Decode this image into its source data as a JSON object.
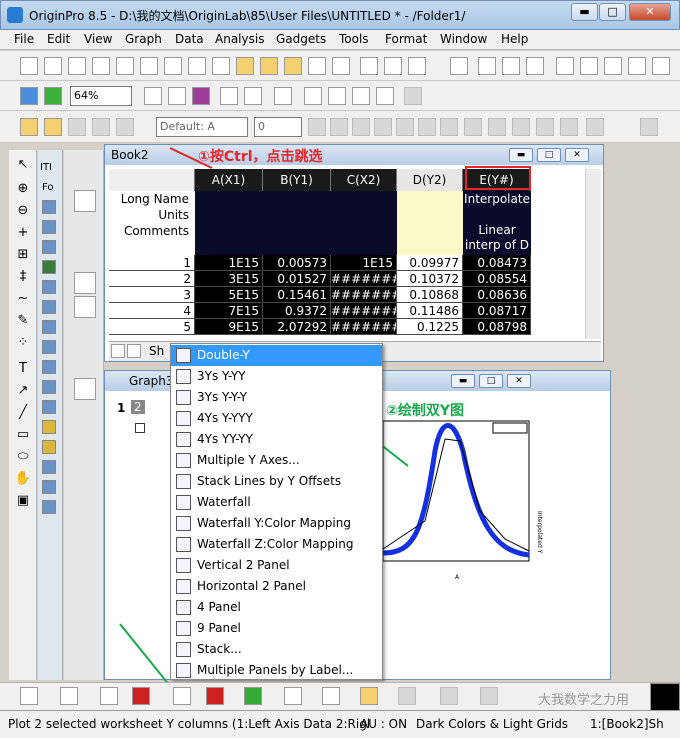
{
  "window": {
    "title": "OriginPro 8.5 - D:\\我的文档\\OriginLab\\85\\User Files\\UNTITLED * - /Folder1/",
    "min": "▬",
    "max": "□",
    "close": "✕"
  },
  "menu": [
    "File",
    "Edit",
    "View",
    "Graph",
    "Data",
    "Analysis",
    "Gadgets",
    "Tools",
    "Format",
    "Window",
    "Help"
  ],
  "toolbar": {
    "zoom": "64%",
    "font": "Default: A",
    "fontsize": "0"
  },
  "book2": {
    "title": "Book2",
    "row_labels": [
      "Long Name",
      "Units",
      "Comments"
    ],
    "columns": [
      "A(X1)",
      "B(Y1)",
      "C(X2)",
      "D(Y2)",
      "E(Y#)"
    ],
    "e_longname": "Interpolate",
    "e_comments": "Linear interp of D",
    "rows": [
      {
        "n": "1",
        "a": "1E15",
        "b": "0.00573",
        "c": "1E15",
        "d": "0.09977",
        "e": "0.08473"
      },
      {
        "n": "2",
        "a": "3E15",
        "b": "0.01527",
        "c": "########",
        "d": "0.10372",
        "e": "0.08554"
      },
      {
        "n": "3",
        "a": "5E15",
        "b": "0.15461",
        "c": "########",
        "d": "0.10868",
        "e": "0.08636"
      },
      {
        "n": "4",
        "a": "7E15",
        "b": "0.9372",
        "c": "########",
        "d": "0.11486",
        "e": "0.08717"
      },
      {
        "n": "5",
        "a": "9E15",
        "b": "2.07292",
        "c": "########",
        "d": "0.1225",
        "e": "0.08798"
      }
    ],
    "sheet_tab": "Sh"
  },
  "graph3": {
    "title": "Graph3",
    "layer1": "1",
    "layer2": "2",
    "right_axis_label": "Interpolated Y",
    "x_axis_label": "A"
  },
  "annotations": {
    "step1": "①按Ctrl，点击跳选",
    "step2": "②绘制双Y图"
  },
  "dropdown": [
    "Double-Y",
    "3Ys Y-YY",
    "3Ys Y-Y-Y",
    "4Ys Y-YYY",
    "4Ys YY-YY",
    "Multiple Y Axes...",
    "Stack Lines by Y Offsets",
    "Waterfall",
    "Waterfall Y:Color Mapping",
    "Waterfall Z:Color Mapping",
    "Vertical 2 Panel",
    "Horizontal 2 Panel",
    "4 Panel",
    "9 Panel",
    "Stack...",
    "Multiple Panels by Label..."
  ],
  "status": {
    "left": "Plot 2 selected worksheet Y columns (1:Left Axis Data 2:Rigl",
    "au": "AU : ON",
    "theme": "Dark Colors & Light Grids",
    "book": "1:[Book2]Sh"
  },
  "watermark": "大我数学之力用"
}
